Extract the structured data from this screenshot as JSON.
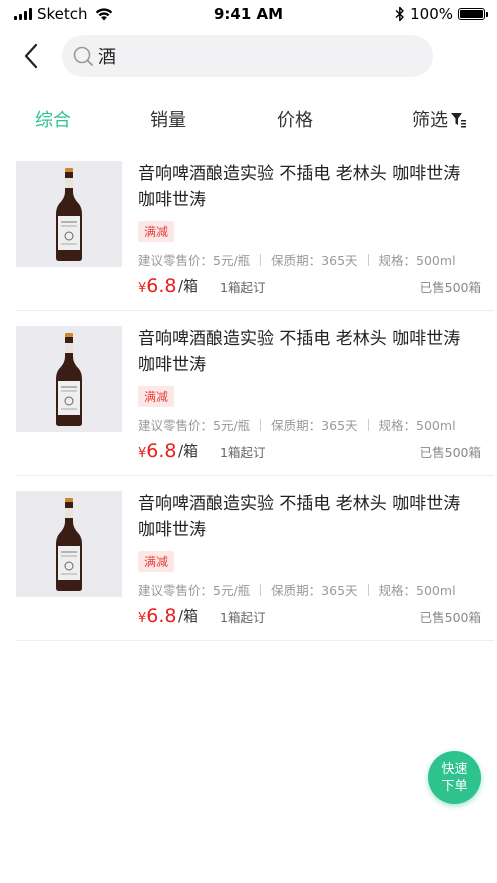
{
  "status_bar": {
    "carrier": "Sketch",
    "time": "9:41 AM",
    "battery": "100%",
    "battery_level": 1.0
  },
  "search": {
    "value": "酒",
    "placeholder": ""
  },
  "tabs": [
    {
      "label": "综合",
      "active": true
    },
    {
      "label": "销量",
      "active": false
    },
    {
      "label": "价格",
      "active": false
    },
    {
      "label": "筛选",
      "active": false,
      "icon": "filter-icon"
    }
  ],
  "products": [
    {
      "title": "音响啤酒酿造实验 不插电 老林头 咖啡世涛　咖啡世涛",
      "promo": "满减",
      "retail_price": "建议零售价：5元/瓶",
      "shelf_life": "保质期：365天",
      "spec": "规格：500ml",
      "currency": "¥",
      "price": "6.8",
      "unit": "/箱",
      "min_order": "1箱起订",
      "sold": "已售500箱"
    },
    {
      "title": "音响啤酒酿造实验 不插电 老林头 咖啡世涛　咖啡世涛",
      "promo": "满减",
      "retail_price": "建议零售价：5元/瓶",
      "shelf_life": "保质期：365天",
      "spec": "规格：500ml",
      "currency": "¥",
      "price": "6.8",
      "unit": "/箱",
      "min_order": "1箱起订",
      "sold": "已售500箱"
    },
    {
      "title": "音响啤酒酿造实验 不插电 老林头 咖啡世涛　咖啡世涛",
      "promo": "满减",
      "retail_price": "建议零售价：5元/瓶",
      "shelf_life": "保质期：365天",
      "spec": "规格：500ml",
      "currency": "¥",
      "price": "6.8",
      "unit": "/箱",
      "min_order": "1箱起订",
      "sold": "已售500箱"
    }
  ],
  "fab": {
    "line1": "快速",
    "line2": "下单"
  },
  "colors": {
    "accent": "#2ec38e",
    "price": "#e8201e",
    "promo_bg": "#fde8e8"
  }
}
